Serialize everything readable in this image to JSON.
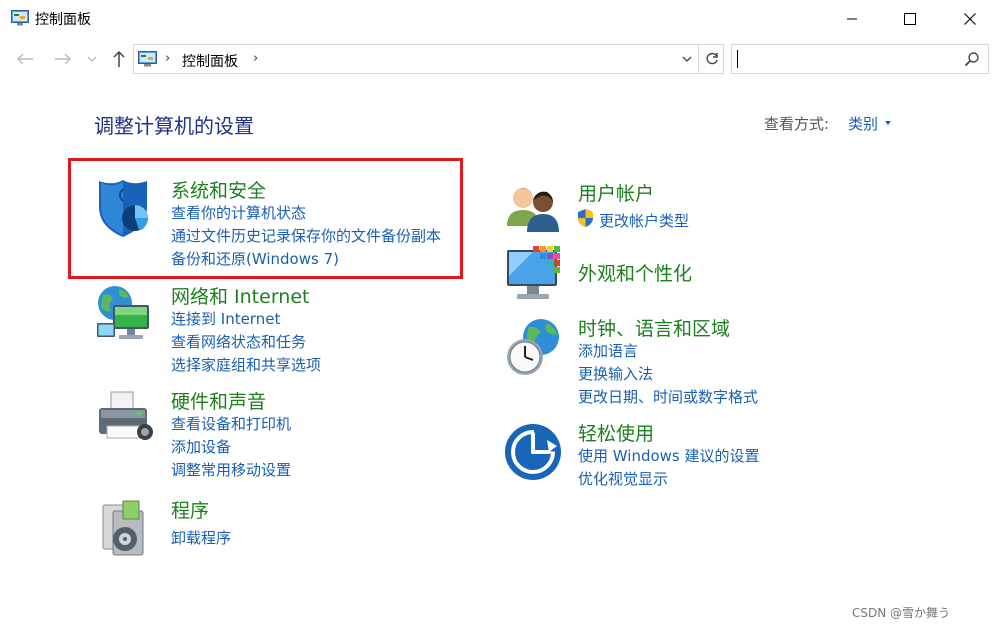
{
  "window": {
    "title": "控制面板",
    "controls": {
      "minimize": "minimize-icon",
      "maximize": "maximize-icon",
      "close": "close-icon"
    }
  },
  "navbar": {
    "breadcrumb": [
      "控制面板"
    ],
    "search": {
      "value": "",
      "placeholder": ""
    }
  },
  "content": {
    "page_title": "调整计算机的设置",
    "view_by": {
      "label": "查看方式:",
      "value": "类别"
    },
    "left_categories": [
      {
        "title": "系统和安全",
        "icon": "shield-icon",
        "links": [
          "查看你的计算机状态",
          "通过文件历史记录保存你的文件备份副本",
          "备份和还原(Windows 7)"
        ]
      },
      {
        "title": "网络和 Internet",
        "icon": "network-globe-icon",
        "links": [
          "连接到 Internet",
          "查看网络状态和任务",
          "选择家庭组和共享选项"
        ]
      },
      {
        "title": "硬件和声音",
        "icon": "printer-icon",
        "links": [
          "查看设备和打印机",
          "添加设备",
          "调整常用移动设置"
        ]
      },
      {
        "title": "程序",
        "icon": "programs-icon",
        "links": [
          "卸载程序"
        ]
      }
    ],
    "right_categories": [
      {
        "title": "用户帐户",
        "icon": "users-icon",
        "links": [
          "更改帐户类型"
        ]
      },
      {
        "title": "外观和个性化",
        "icon": "monitor-icon",
        "links": []
      },
      {
        "title": "时钟、语言和区域",
        "icon": "clock-globe-icon",
        "links": [
          "添加语言",
          "更换输入法",
          "更改日期、时间或数字格式"
        ]
      },
      {
        "title": "轻松使用",
        "icon": "ease-of-access-icon",
        "links": [
          "使用 Windows 建议的设置",
          "优化视觉显示"
        ]
      }
    ]
  },
  "watermark": "CSDN @雪か舞う",
  "colors": {
    "title_blue": "#1e3287",
    "link_blue": "#1a5fb4",
    "category_green": "#1e7f1e",
    "highlight_red": "#e0181e"
  }
}
